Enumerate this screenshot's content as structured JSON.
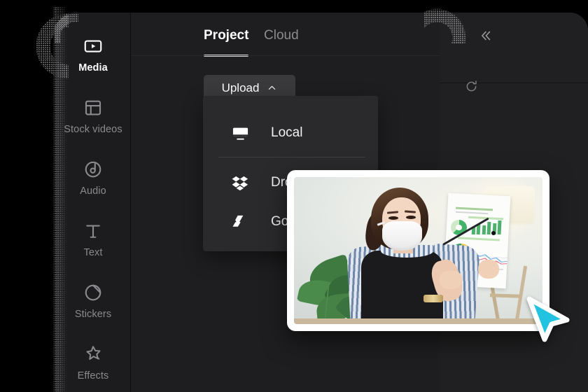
{
  "sidebar": {
    "items": [
      {
        "label": "Media",
        "icon": "media-play-icon",
        "active": true
      },
      {
        "label": "Stock videos",
        "icon": "layout-grid-icon",
        "active": false
      },
      {
        "label": "Audio",
        "icon": "audio-note-icon",
        "active": false
      },
      {
        "label": "Text",
        "icon": "text-t-icon",
        "active": false
      },
      {
        "label": "Stickers",
        "icon": "sticker-circle-icon",
        "active": false
      },
      {
        "label": "Effects",
        "icon": "effects-star-icon",
        "active": false
      }
    ]
  },
  "panel": {
    "tabs": [
      {
        "id": "project",
        "label": "Project",
        "active": true
      },
      {
        "id": "cloud",
        "label": "Cloud",
        "active": false
      }
    ],
    "collapse_icon": "chevron-double-left-icon",
    "upload": {
      "label": "Upload",
      "caret_icon": "chevron-up-icon"
    },
    "refresh_icon": "refresh-icon",
    "menu": {
      "items": [
        {
          "label": "Local",
          "icon": "monitor-icon"
        },
        {
          "label": "Dropbox",
          "icon": "dropbox-icon"
        },
        {
          "label": "Google Drive",
          "icon": "google-drive-icon"
        }
      ]
    }
  },
  "media_item": {
    "alt": "woman-in-mask-presenting-chart-report",
    "type": "image-thumbnail"
  },
  "cursor": {
    "icon": "arrow-pointer-cursor",
    "color": "#22c3e0"
  },
  "colors": {
    "app_background": "#000000",
    "window": "#1c1c1e",
    "panel": "#1e1e20",
    "panel_alt": "#202022",
    "menu": "#2a2a2c",
    "button": "#3a3a3c",
    "text_primary": "#ffffff",
    "text_muted": "#8a8a8e",
    "accent_cursor": "#22c3e0"
  }
}
